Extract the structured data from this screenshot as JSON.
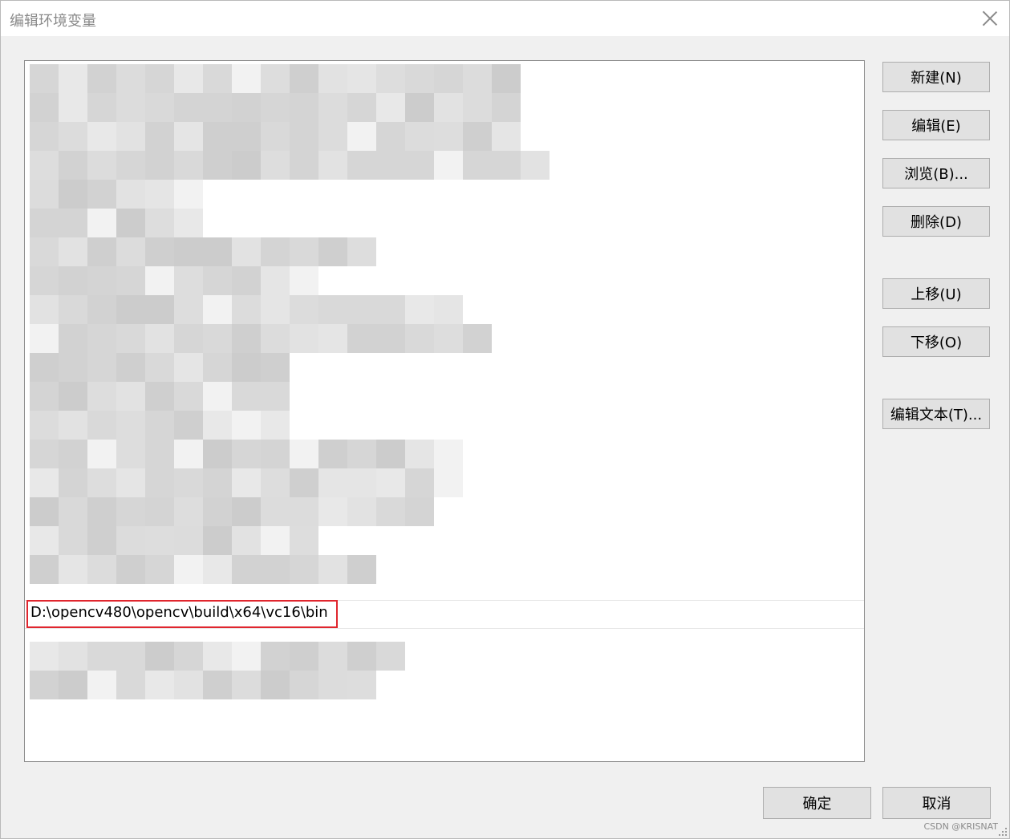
{
  "window": {
    "title": "编辑环境变量"
  },
  "list": {
    "selected_entry": "D:\\opencv480\\opencv\\build\\x64\\vc16\\bin",
    "other_entries_redacted": true
  },
  "buttons": {
    "new": "新建(N)",
    "edit": "编辑(E)",
    "browse": "浏览(B)...",
    "delete": "删除(D)",
    "move_up": "上移(U)",
    "move_down": "下移(O)",
    "edit_text": "编辑文本(T)...",
    "ok": "确定",
    "cancel": "取消"
  },
  "watermark": "CSDN @KRISNAT",
  "colors": {
    "highlight": "#e0262e",
    "button_bg": "#e1e1e1",
    "dialog_bg": "#f0f0f0"
  }
}
